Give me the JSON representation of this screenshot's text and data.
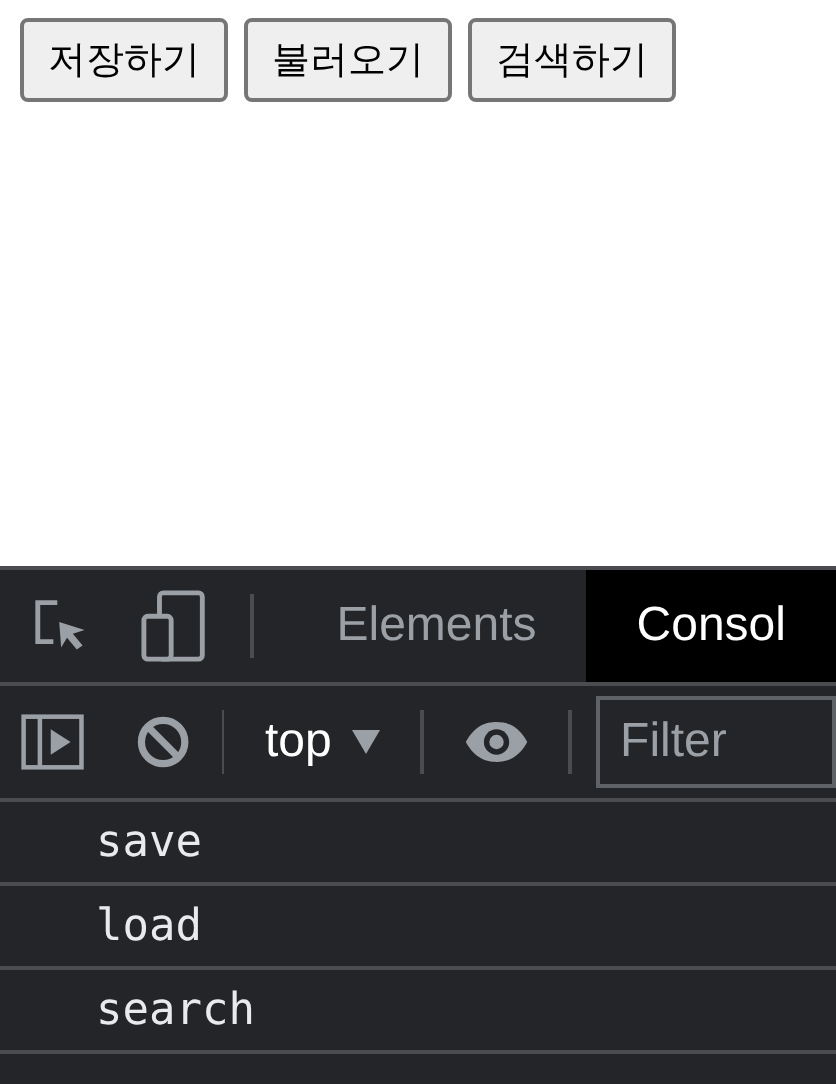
{
  "buttons": [
    "저장하기",
    "불러오기",
    "검색하기"
  ],
  "devtools": {
    "tabs": [
      {
        "label": "Elements",
        "selected": false
      },
      {
        "label": "Consol",
        "selected": true
      }
    ],
    "context": "top",
    "filter": {
      "placeholder": "Filter"
    },
    "console_lines": [
      "save",
      "load",
      "search"
    ]
  }
}
